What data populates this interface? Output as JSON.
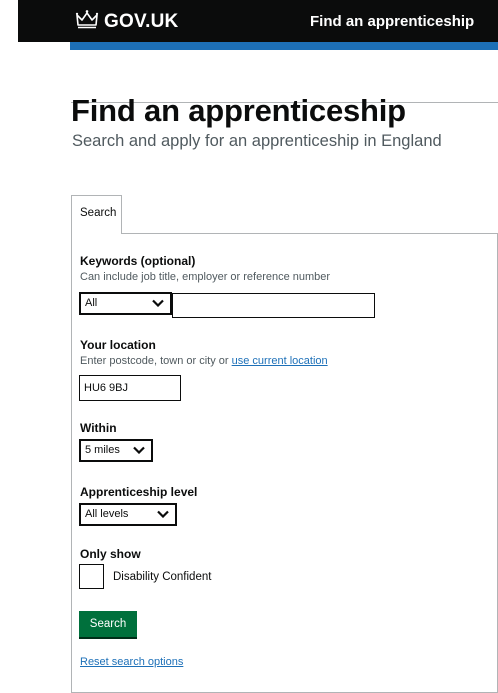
{
  "header": {
    "logo_text": "GOV.UK",
    "service_name": "Find an apprenticeship",
    "colors": {
      "background": "#0b0c0c",
      "accent": "#1d70b8"
    }
  },
  "page": {
    "title": "Find an apprenticeship",
    "subtitle": "Search and apply for an apprenticeship in England"
  },
  "tabs": [
    {
      "label": "Search"
    }
  ],
  "form": {
    "keywords": {
      "label": "Keywords (optional)",
      "hint": "Can include job title, employer or reference number",
      "scope_selected": "All",
      "value": ""
    },
    "location": {
      "label": "Your location",
      "hint_prefix": "Enter postcode, town or city or ",
      "hint_link": "use current location",
      "value": "HU6 9BJ"
    },
    "within": {
      "label": "Within",
      "selected": "5 miles"
    },
    "level": {
      "label": "Apprenticeship level",
      "selected": "All levels"
    },
    "only_show": {
      "label": "Only show",
      "checkbox_label": "Disability Confident",
      "checked": false
    },
    "search_button": "Search",
    "reset_link": "Reset search options",
    "colors": {
      "button": "#00703c",
      "link": "#1d70b8"
    }
  }
}
